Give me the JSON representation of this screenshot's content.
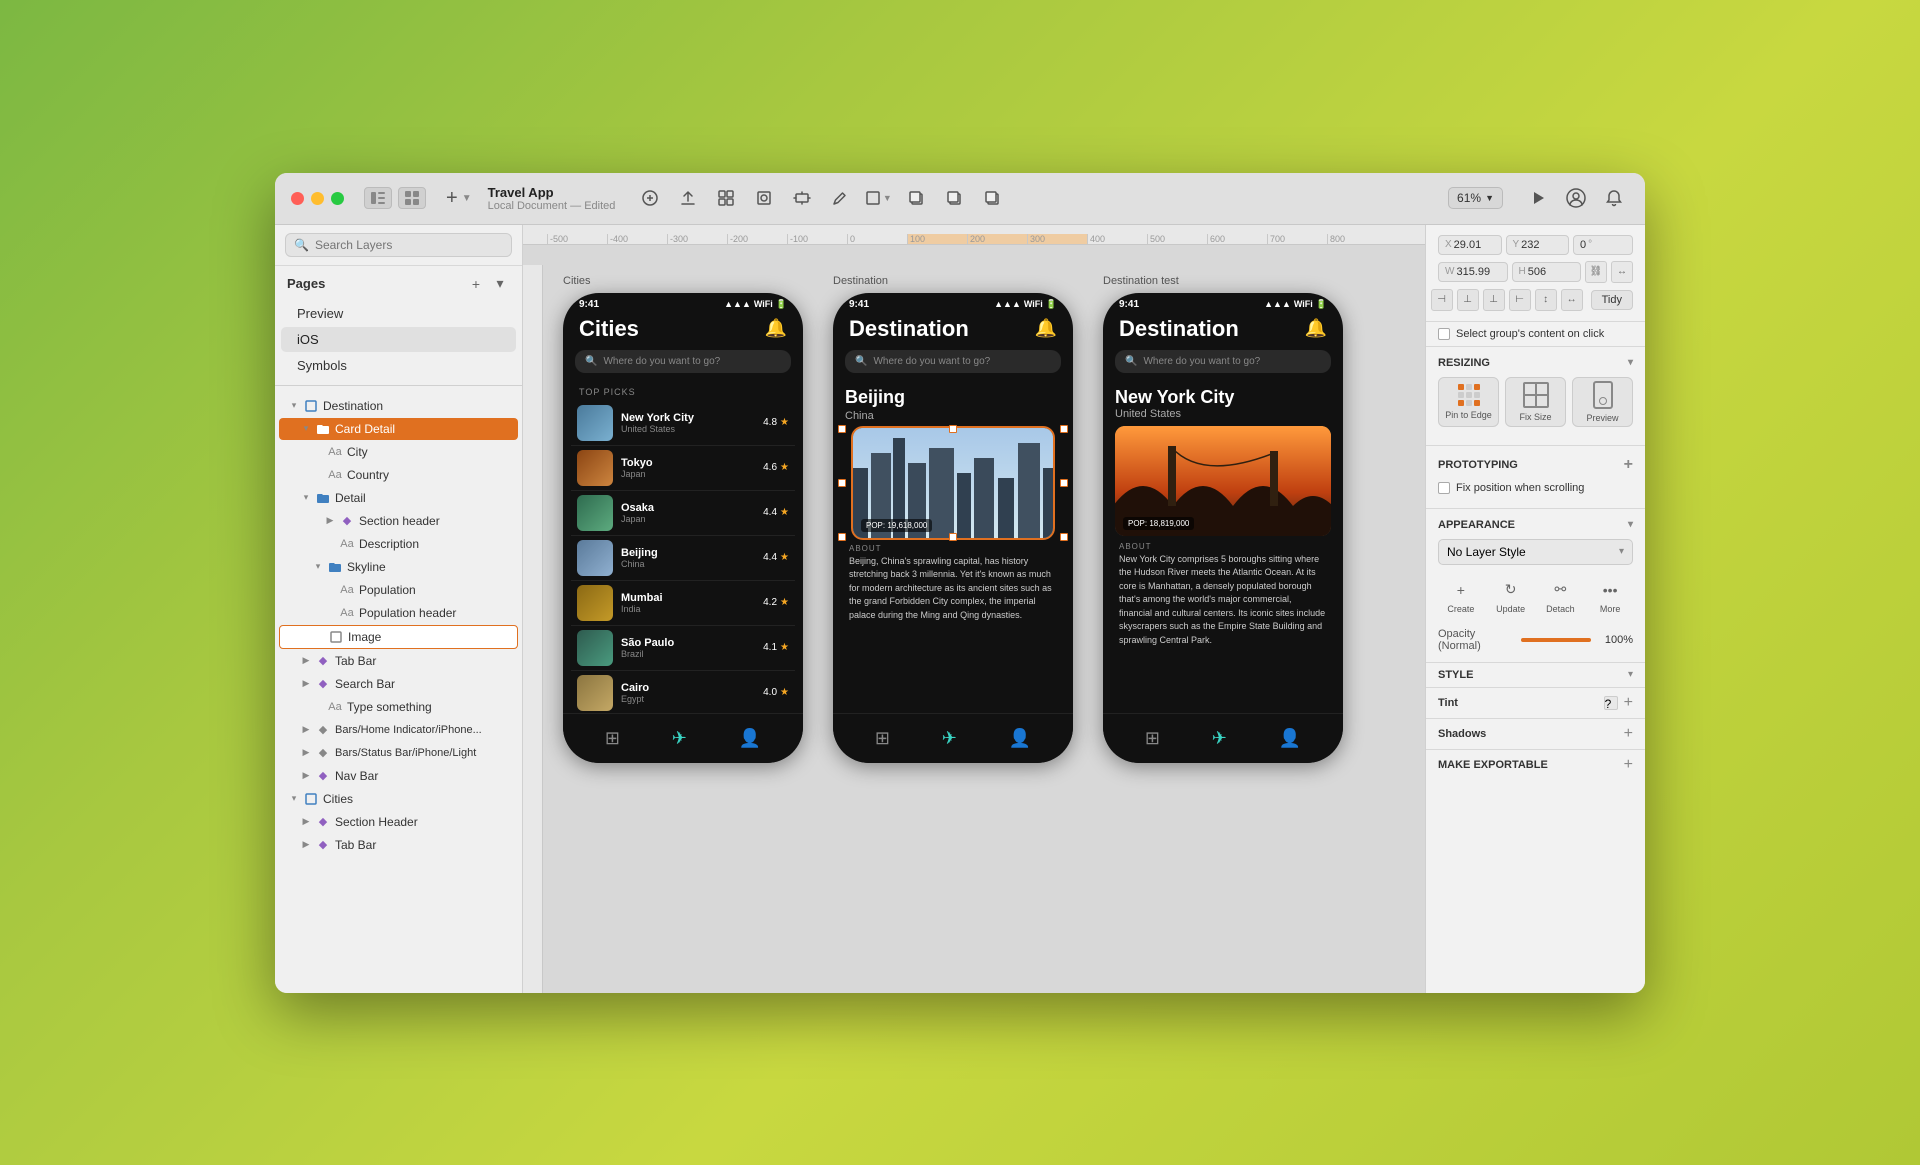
{
  "app": {
    "title": "Travel App",
    "subtitle": "Local Document — Edited"
  },
  "toolbar": {
    "zoom_label": "61%",
    "add_label": "+",
    "search_placeholder": "Search Layers"
  },
  "pages": {
    "label": "Pages",
    "items": [
      {
        "id": "preview",
        "label": "Preview"
      },
      {
        "id": "ios",
        "label": "iOS",
        "selected": true
      },
      {
        "id": "symbols",
        "label": "Symbols"
      }
    ]
  },
  "layers": {
    "destination_group": {
      "label": "Destination",
      "children": [
        {
          "label": "Card Detail",
          "selected": true,
          "type": "folder_orange"
        },
        {
          "label": "City",
          "type": "text",
          "indent": 2
        },
        {
          "label": "Country",
          "type": "text",
          "indent": 2
        },
        {
          "label": "Detail",
          "type": "folder",
          "indent": 1
        },
        {
          "label": "Section header",
          "type": "component_purple",
          "indent": 3
        },
        {
          "label": "Description",
          "type": "text",
          "indent": 3
        },
        {
          "label": "Skyline",
          "type": "folder",
          "indent": 2
        },
        {
          "label": "Population",
          "type": "text",
          "indent": 3
        },
        {
          "label": "Population header",
          "type": "text",
          "indent": 3
        },
        {
          "label": "Image",
          "type": "artboard",
          "indent": 2,
          "selected_item": true
        }
      ]
    },
    "more_items": [
      {
        "label": "Tab Bar",
        "type": "component_purple",
        "indent": 1
      },
      {
        "label": "Search Bar",
        "type": "component_purple",
        "indent": 1
      },
      {
        "label": "Type something",
        "type": "text",
        "indent": 2
      },
      {
        "label": "Bars/Home Indicator/iPhone...",
        "type": "component_gray",
        "indent": 1
      },
      {
        "label": "Bars/Status Bar/iPhone/Light",
        "type": "component_gray",
        "indent": 1
      },
      {
        "label": "Nav Bar",
        "type": "component_purple",
        "indent": 1
      }
    ],
    "cities_group": {
      "label": "Cities",
      "children": [
        {
          "label": "Section Header",
          "type": "component_purple",
          "indent": 1
        },
        {
          "label": "Tab Bar",
          "type": "component_purple",
          "indent": 1
        }
      ]
    }
  },
  "artboards": [
    {
      "id": "cities",
      "label": "Cities",
      "phone_title": "Cities",
      "search_placeholder": "Where do you want to go?",
      "top_picks_label": "TOP PICKS",
      "cities": [
        {
          "name": "New York City",
          "country": "United States",
          "rating": "4.8",
          "color": "nyc"
        },
        {
          "name": "Tokyo",
          "country": "Japan",
          "rating": "4.6",
          "color": "tokyo"
        },
        {
          "name": "Osaka",
          "country": "Japan",
          "rating": "4.4",
          "color": "osaka"
        },
        {
          "name": "Beijing",
          "country": "China",
          "rating": "4.4",
          "color": "beijing"
        },
        {
          "name": "Mumbai",
          "country": "India",
          "rating": "4.2",
          "color": "mumbai"
        },
        {
          "name": "São Paulo",
          "country": "Brazil",
          "rating": "4.1",
          "color": "saopaulo"
        },
        {
          "name": "Cairo",
          "country": "Egypt",
          "rating": "4.0",
          "color": "cairo"
        }
      ]
    },
    {
      "id": "destination",
      "label": "Destination",
      "phone_title": "Destination",
      "city_name": "Beijing",
      "country": "China",
      "population": "POP: 19,618,000",
      "about_text": "Beijing, China's sprawling capital, has history stretching back 3 millennia. Yet it's known as much for modern architecture as its ancient sites such as the grand Forbidden City complex, the imperial palace during the Ming and Qing dynasties."
    },
    {
      "id": "destination_test",
      "label": "Destination test",
      "phone_title": "Destination",
      "city_name": "New York City",
      "country": "United States",
      "population": "POP: 18,819,000",
      "about_text": "New York City comprises 5 boroughs sitting where the Hudson River meets the Atlantic Ocean. At its core is Manhattan, a densely populated borough that's among the world's major commercial, financial and cultural centers. Its iconic sites include skyscrapers such as the Empire State Building and sprawling Central Park."
    }
  ],
  "right_panel": {
    "coords": {
      "x_label": "X",
      "x_value": "29.01",
      "y_label": "Y",
      "y_value": "232",
      "angle_value": "0",
      "angle_unit": "°",
      "w_label": "W",
      "w_value": "315.99",
      "h_label": "H",
      "h_value": "506"
    },
    "tidy_label": "Tidy",
    "select_group_label": "Select group's content on click",
    "resizing_label": "RESIZING",
    "resize_options": [
      {
        "label": "Pin to Edge"
      },
      {
        "label": "Fix Size"
      },
      {
        "label": "Preview"
      }
    ],
    "prototyping_label": "PROTOTYPING",
    "fix_position_label": "Fix position when scrolling",
    "appearance_label": "APPEARANCE",
    "layer_style_label": "No Layer Style",
    "style_actions": [
      {
        "label": "Create",
        "icon": "+"
      },
      {
        "label": "Update",
        "icon": "↻"
      },
      {
        "label": "Detach",
        "icon": "⚯"
      },
      {
        "label": "More",
        "icon": "···"
      }
    ],
    "opacity_label": "Opacity (Normal)",
    "opacity_value": "100%",
    "style_label": "STYLE",
    "tint_label": "Tint",
    "shadows_label": "Shadows",
    "export_label": "MAKE EXPORTABLE"
  },
  "ruler": {
    "ticks": [
      "-500",
      "-400",
      "-300",
      "-200",
      "-100",
      "0",
      "100",
      "200",
      "300",
      "400",
      "500",
      "600",
      "700",
      "800"
    ]
  }
}
